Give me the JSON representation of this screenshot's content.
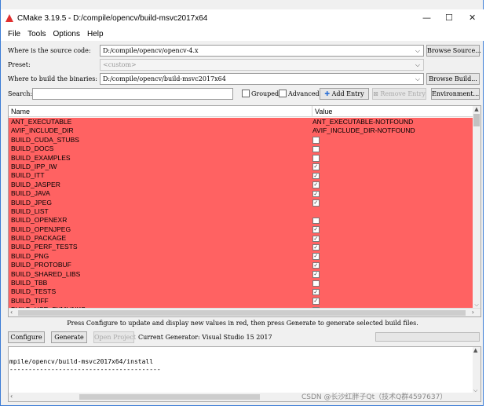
{
  "window": {
    "title": "CMake 3.19.5 - D:/compile/opencv/build-msvc2017x64",
    "controls": [
      "—",
      "☐",
      "✕"
    ]
  },
  "menu": [
    "File",
    "Tools",
    "Options",
    "Help"
  ],
  "source": {
    "label": "Where is the source code:",
    "value": "D:/compile/opencv/opencv-4.x",
    "button": "Browse Source..."
  },
  "preset": {
    "label": "Preset:",
    "value": "<custom>"
  },
  "build": {
    "label": "Where to build the binaries:",
    "value": "D:/compile/opencv/build-msvc2017x64",
    "button": "Browse Build..."
  },
  "search": {
    "label": "Search:",
    "value": ""
  },
  "options": {
    "grouped": "Grouped",
    "advanced": "Advanced",
    "add_entry": "Add Entry",
    "remove_entry": "Remove Entry",
    "environment": "Environment..."
  },
  "table": {
    "col_name": "Name",
    "col_value": "Value",
    "row_color": "#ff6262",
    "rows": [
      {
        "name": "ANT_EXECUTABLE",
        "type": "text",
        "value": "ANT_EXECUTABLE-NOTFOUND"
      },
      {
        "name": "AVIF_INCLUDE_DIR",
        "type": "text",
        "value": "AVIF_INCLUDE_DIR-NOTFOUND"
      },
      {
        "name": "BUILD_CUDA_STUBS",
        "type": "bool",
        "checked": false
      },
      {
        "name": "BUILD_DOCS",
        "type": "bool",
        "checked": false
      },
      {
        "name": "BUILD_EXAMPLES",
        "type": "bool",
        "checked": false
      },
      {
        "name": "BUILD_IPP_IW",
        "type": "bool",
        "checked": true
      },
      {
        "name": "BUILD_ITT",
        "type": "bool",
        "checked": true
      },
      {
        "name": "BUILD_JASPER",
        "type": "bool",
        "checked": true
      },
      {
        "name": "BUILD_JAVA",
        "type": "bool",
        "checked": true
      },
      {
        "name": "BUILD_JPEG",
        "type": "bool",
        "checked": true
      },
      {
        "name": "BUILD_LIST",
        "type": "text",
        "value": ""
      },
      {
        "name": "BUILD_OPENEXR",
        "type": "bool",
        "checked": false
      },
      {
        "name": "BUILD_OPENJPEG",
        "type": "bool",
        "checked": true
      },
      {
        "name": "BUILD_PACKAGE",
        "type": "bool",
        "checked": true
      },
      {
        "name": "BUILD_PERF_TESTS",
        "type": "bool",
        "checked": true
      },
      {
        "name": "BUILD_PNG",
        "type": "bool",
        "checked": true
      },
      {
        "name": "BUILD_PROTOBUF",
        "type": "bool",
        "checked": true
      },
      {
        "name": "BUILD_SHARED_LIBS",
        "type": "bool",
        "checked": true
      },
      {
        "name": "BUILD_TBB",
        "type": "bool",
        "checked": false
      },
      {
        "name": "BUILD_TESTS",
        "type": "bool",
        "checked": true
      },
      {
        "name": "BUILD_TIFF",
        "type": "bool",
        "checked": true
      },
      {
        "name": "BUILD_USE_SYMLINKS",
        "type": "bool",
        "checked": false
      }
    ]
  },
  "info_text": "Press Configure to update and display new values in red, then press Generate to generate selected build files.",
  "actions": {
    "configure": "Configure",
    "generate": "Generate",
    "open_project": "Open Project",
    "generator": "Current Generator: Visual Studio 15 2017"
  },
  "output": {
    "lines": [
      "mpile/opencv/build-msvc2017x64/install",
      "----------------------------------------"
    ]
  },
  "watermark": "CSDN @长沙红胖子Qt（技术Q群4597637）"
}
